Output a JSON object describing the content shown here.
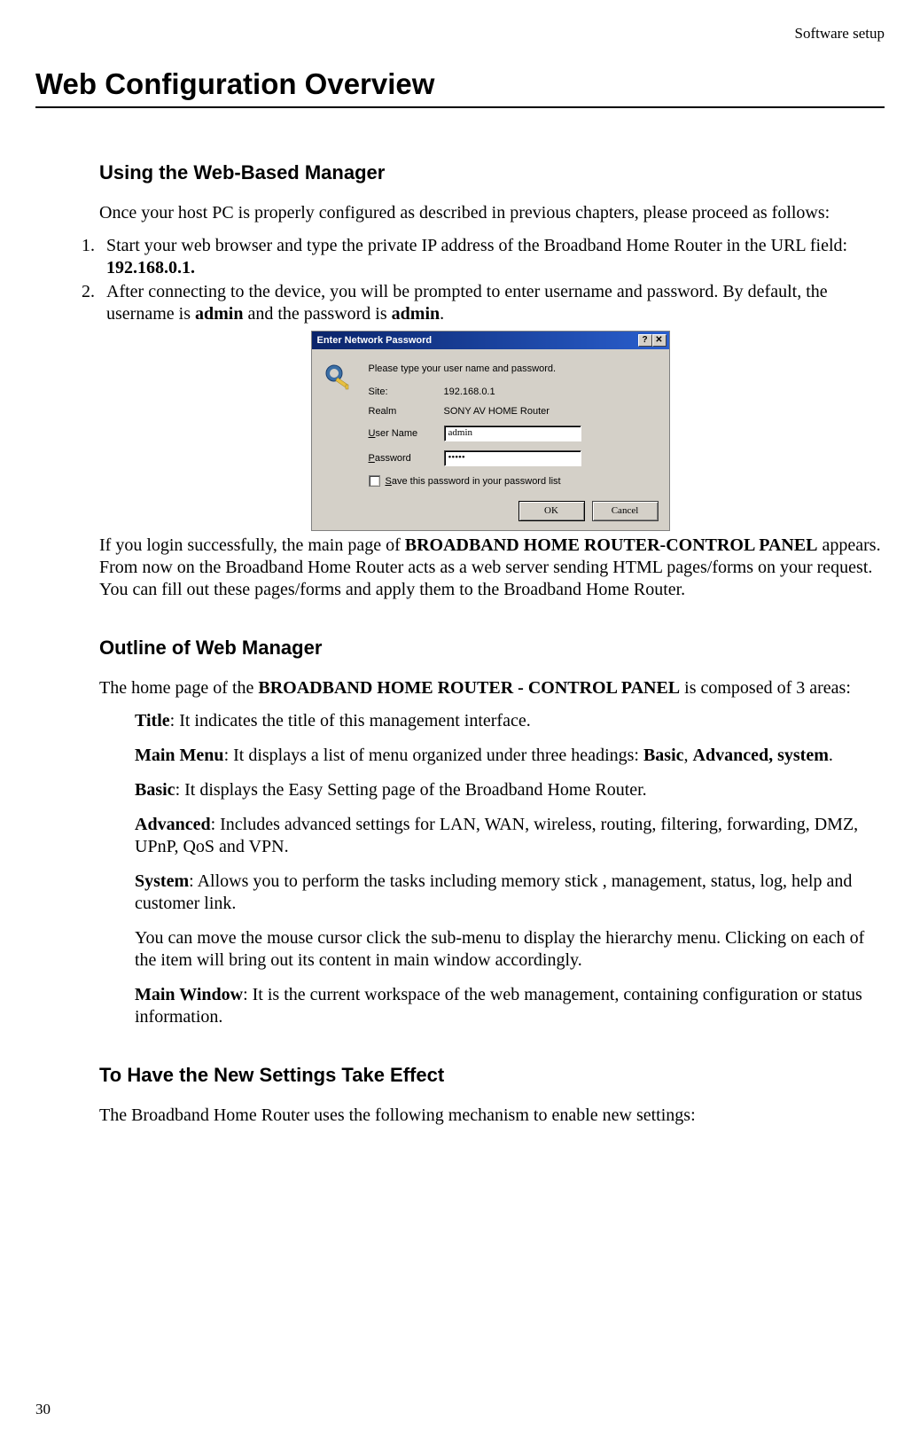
{
  "header": {
    "right": "Software setup"
  },
  "title": "Web Configuration Overview",
  "s1": {
    "heading": "Using the Web-Based Manager",
    "intro": "Once your host PC is properly configured as described in previous chapters, please proceed as follows:",
    "step1_a": "Start your web browser and type the private IP address of the Broadband Home Router in the URL field: ",
    "step1_b": "192.168.0.1.",
    "step2_a": "After connecting to the device, you will be prompted to enter username and password. By default, the username is ",
    "step2_b": "admin",
    "step2_c": " and the password is ",
    "step2_d": "admin",
    "step2_e": ".",
    "after_a": "If you login successfully, the main page of ",
    "after_b": "BROADBAND HOME ROUTER-CONTROL PANEL",
    "after_c": " appears. From now on the Broadband Home Router acts as a web server sending HTML pages/forms on your request. You can fill out these pages/forms and apply them to the Broadband Home Router."
  },
  "dialog": {
    "title": "Enter Network Password",
    "help_btn": "?",
    "close_btn": "✕",
    "prompt": "Please type your user name and password.",
    "site_label": "Site:",
    "site_value": "192.168.0.1",
    "realm_label": "Realm",
    "realm_value": "SONY AV HOME Router",
    "user_label_u": "U",
    "user_label_rest": "ser Name",
    "user_value": "admin",
    "pass_label_u": "P",
    "pass_label_rest": "assword",
    "pass_value": "•••••",
    "save_u": "S",
    "save_rest": "ave this password in your password list",
    "ok": "OK",
    "cancel": "Cancel"
  },
  "s2": {
    "heading": "Outline of Web Manager",
    "intro_a": "The home page of the ",
    "intro_b": "BROADBAND HOME ROUTER - CONTROL PANEL",
    "intro_c": " is composed of 3 areas:",
    "d1_a": "Title",
    "d1_b": ": It indicates the title of this management interface.",
    "d2_a": "Main Menu",
    "d2_b": ": It displays a list of menu organized under three headings: ",
    "d2_c": "Basic",
    "d2_d": ", ",
    "d2_e": "Advanced, system",
    "d2_f": ".",
    "d3_a": "Basic",
    "d3_b": ": It displays the Easy Setting page of the Broadband Home Router.",
    "d4_a": "Advanced",
    "d4_b": ": Includes advanced settings for LAN, WAN, wireless, routing, filtering, forwarding, DMZ, UPnP, QoS and VPN.",
    "d5_a": "System",
    "d5_b": ": Allows you to perform the tasks including memory stick , management, status, log, help and customer link.",
    "d6": "You can move the mouse cursor click the sub-menu to display the hierarchy menu. Clicking on each of the item will bring out its content in main window accordingly.",
    "d7_a": "Main Window",
    "d7_b": ": It is the current workspace of the web management, containing configuration or status information."
  },
  "s3": {
    "heading": "To Have the New Settings Take Effect",
    "body": "The Broadband Home Router uses the following mechanism to enable new settings:"
  },
  "page_num": "30"
}
